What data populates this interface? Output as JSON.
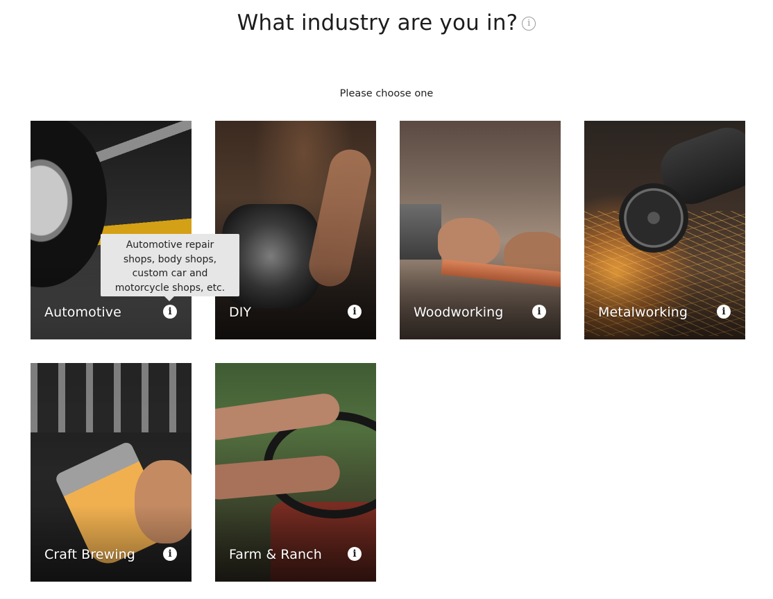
{
  "header": {
    "title": "What industry are you in?",
    "info_icon": "i"
  },
  "subtitle": "Please choose one",
  "cards": [
    {
      "label": "Automotive",
      "info_icon": "i"
    },
    {
      "label": "DIY",
      "info_icon": "i"
    },
    {
      "label": "Woodworking",
      "info_icon": "i"
    },
    {
      "label": "Metalworking",
      "info_icon": "i"
    },
    {
      "label": "Craft Brewing",
      "info_icon": "i"
    },
    {
      "label": "Farm & Ranch",
      "info_icon": "i"
    }
  ],
  "tooltip": {
    "lines": [
      "Automotive repair",
      "shops, body shops,",
      "custom car and",
      "motorcycle shops, etc."
    ]
  }
}
